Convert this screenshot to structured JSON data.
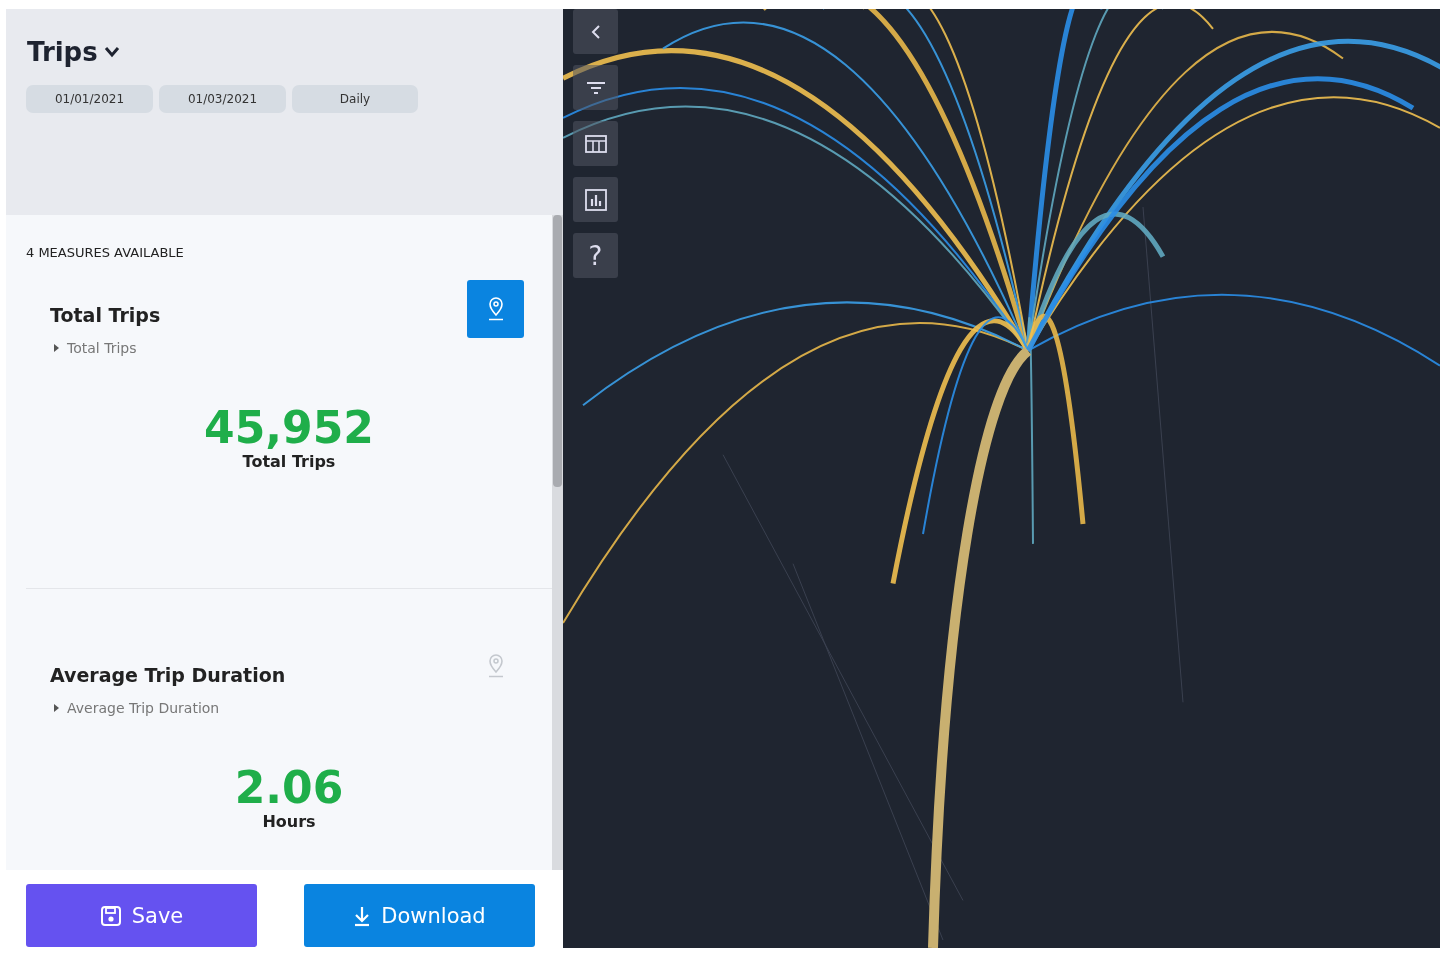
{
  "header": {
    "title": "Trips",
    "filters": [
      "01/01/2021",
      "01/03/2021",
      "Daily"
    ]
  },
  "measures_count": "4 MEASURES AVAILABLE",
  "measures": [
    {
      "title": "Total Trips",
      "subtitle": "Total Trips",
      "value": "45,952",
      "unit": "Total Trips",
      "selected": true
    },
    {
      "title": "Average Trip Duration",
      "subtitle": "Average Trip Duration",
      "value": "2.06",
      "unit": "Hours",
      "selected": false
    }
  ],
  "actions": [
    {
      "kind": "save",
      "label": "Save"
    },
    {
      "kind": "download",
      "label": "Download"
    }
  ],
  "map_toolbar": [
    {
      "kind": "back"
    },
    {
      "kind": "filter"
    },
    {
      "kind": "table"
    },
    {
      "kind": "chart"
    },
    {
      "kind": "help",
      "text": "?"
    }
  ]
}
